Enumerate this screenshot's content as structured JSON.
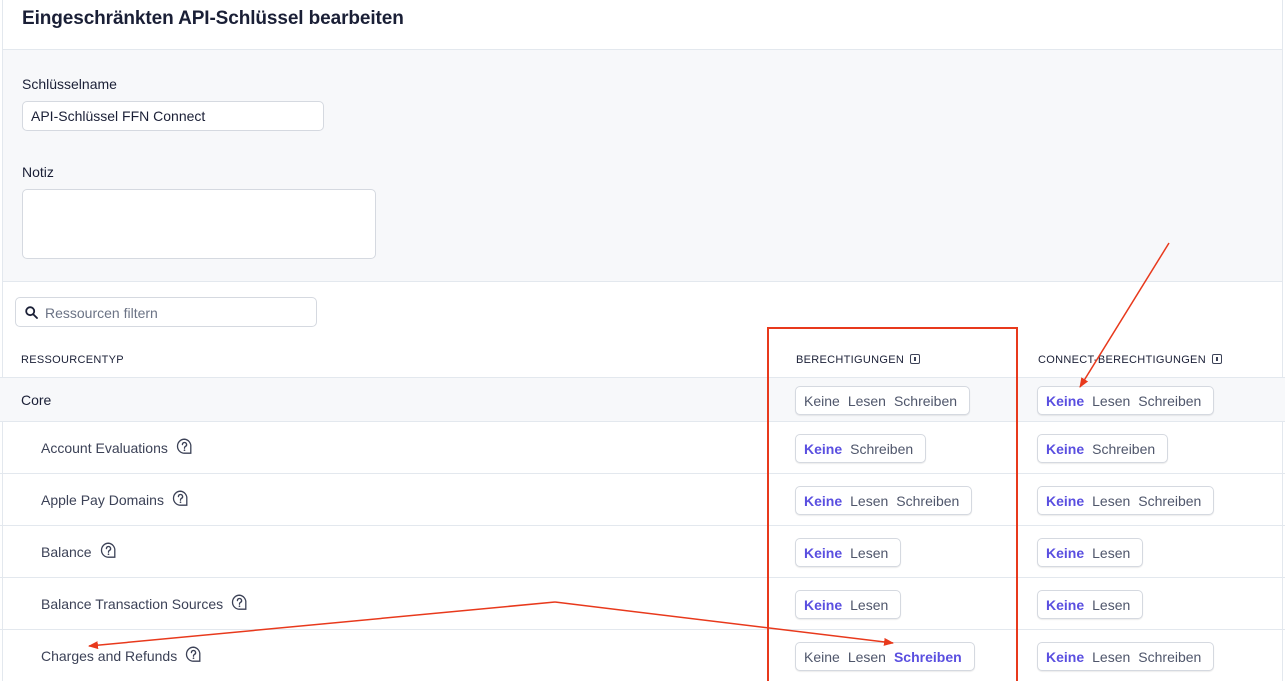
{
  "page": {
    "title": "Eingeschränkten API-Schlüssel bearbeiten"
  },
  "form": {
    "key_name_label": "Schlüsselname",
    "key_name_value": "API-Schlüssel FFN Connect",
    "note_label": "Notiz",
    "note_value": ""
  },
  "search": {
    "placeholder": "Ressourcen filtern",
    "icon": "search-icon"
  },
  "columns": {
    "resource_type": "RESSOURCENTYP",
    "permissions": "BERECHTIGUNGEN",
    "connect_permissions": "CONNECT-BERECHTIGUNGEN"
  },
  "options": {
    "none": "Keine",
    "read": "Lesen",
    "write": "Schreiben"
  },
  "rows": [
    {
      "name": "Core",
      "group": true,
      "permissions": {
        "options": [
          "Keine",
          "Lesen",
          "Schreiben"
        ],
        "selected": null
      },
      "connect": {
        "options": [
          "Keine",
          "Lesen",
          "Schreiben"
        ],
        "selected": "Keine"
      }
    },
    {
      "name": "Account Evaluations",
      "help_icon": "question-bubble-icon",
      "permissions": {
        "options": [
          "Keine",
          "Schreiben"
        ],
        "selected": "Keine"
      },
      "connect": {
        "options": [
          "Keine",
          "Schreiben"
        ],
        "selected": "Keine"
      }
    },
    {
      "name": "Apple Pay Domains",
      "help_icon": "question-bubble-icon",
      "permissions": {
        "options": [
          "Keine",
          "Lesen",
          "Schreiben"
        ],
        "selected": "Keine"
      },
      "connect": {
        "options": [
          "Keine",
          "Lesen",
          "Schreiben"
        ],
        "selected": "Keine"
      }
    },
    {
      "name": "Balance",
      "help_icon": "question-bubble-icon",
      "permissions": {
        "options": [
          "Keine",
          "Lesen"
        ],
        "selected": "Keine"
      },
      "connect": {
        "options": [
          "Keine",
          "Lesen"
        ],
        "selected": "Keine"
      }
    },
    {
      "name": "Balance Transaction Sources",
      "help_icon": "question-bubble-icon",
      "permissions": {
        "options": [
          "Keine",
          "Lesen"
        ],
        "selected": "Keine"
      },
      "connect": {
        "options": [
          "Keine",
          "Lesen"
        ],
        "selected": "Keine"
      }
    },
    {
      "name": "Charges and Refunds",
      "help_icon": "question-bubble-icon",
      "permissions": {
        "options": [
          "Keine",
          "Lesen",
          "Schreiben"
        ],
        "selected": "Schreiben"
      },
      "connect": {
        "options": [
          "Keine",
          "Lesen",
          "Schreiben"
        ],
        "selected": "Keine"
      }
    }
  ],
  "colors": {
    "accent": "#5a4fe0",
    "annotation": "#e8391c",
    "border": "#e3e8ee"
  }
}
